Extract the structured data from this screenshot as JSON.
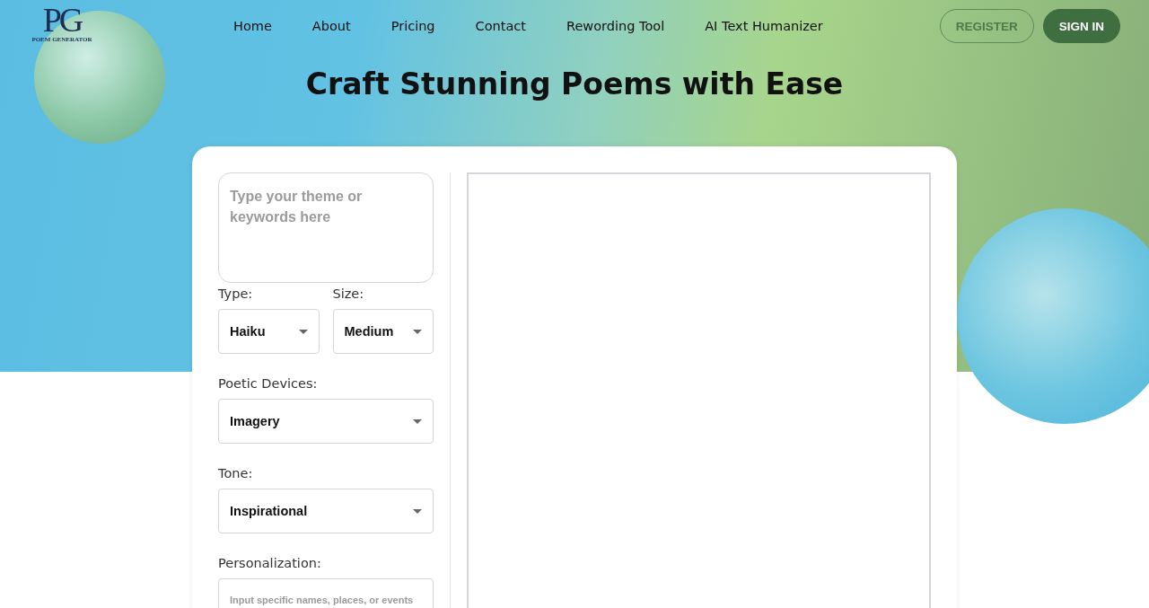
{
  "logo": {
    "mark": "PG",
    "tagline": "POEM GENERATOR"
  },
  "nav": [
    {
      "label": "Home"
    },
    {
      "label": "About"
    },
    {
      "label": "Pricing"
    },
    {
      "label": "Contact"
    },
    {
      "label": "Rewording Tool"
    },
    {
      "label": "AI Text Humanizer"
    }
  ],
  "auth_buttons": [
    {
      "label": "REGISTER",
      "kind": "outline"
    },
    {
      "label": "SIGN IN",
      "kind": "filled"
    }
  ],
  "headline": "Craft Stunning Poems with Ease",
  "form": {
    "theme": {
      "placeholder": "Type your theme or keywords here"
    },
    "pair": [
      {
        "label": "Type:",
        "value": "Haiku"
      },
      {
        "label": "Size:",
        "value": "Medium"
      }
    ],
    "selects": [
      {
        "label": "Poetic Devices:",
        "value": "Imagery"
      },
      {
        "label": "Tone:",
        "value": "Inspirational"
      }
    ],
    "personalization": {
      "label": "Personalization:",
      "placeholder": "Input specific names, places, or events"
    }
  }
}
